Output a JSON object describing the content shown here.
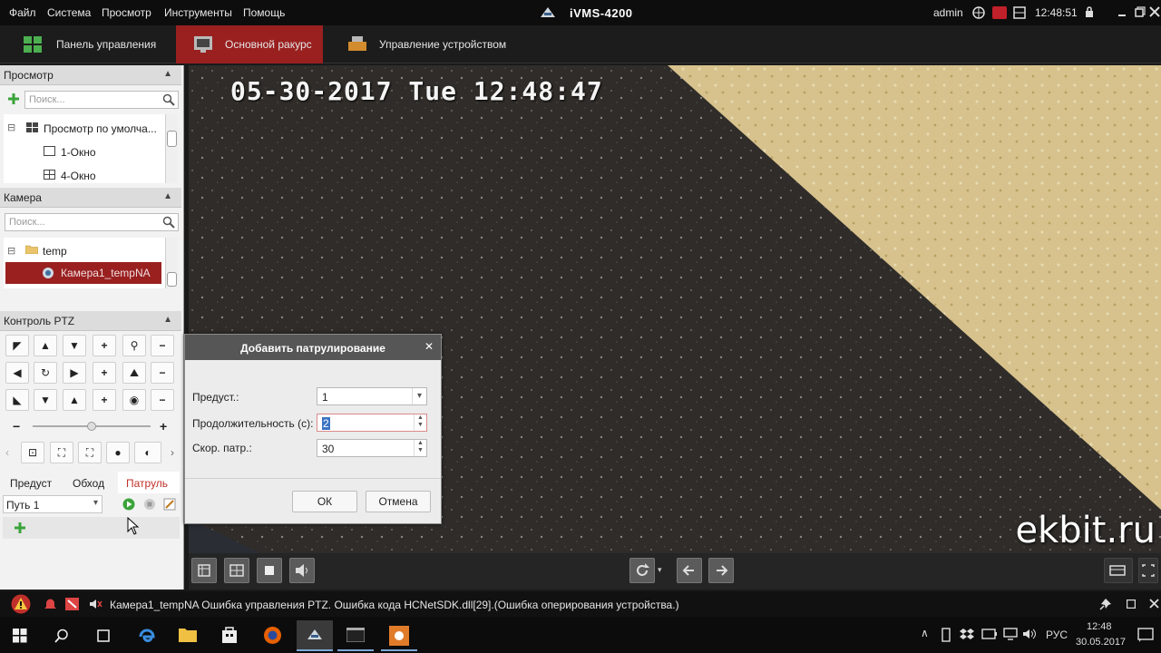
{
  "menubar": {
    "items": [
      "Файл",
      "Система",
      "Просмотр",
      "Инструменты",
      "Помощь"
    ],
    "app_title": "iVMS-4200",
    "user": "admin",
    "clock": "12:48:51"
  },
  "tabs": [
    {
      "label": "Панель управления"
    },
    {
      "label": "Основной ракурс"
    },
    {
      "label": "Управление устройством"
    }
  ],
  "view_section": {
    "title": "Просмотр",
    "search_placeholder": "Поиск...",
    "tree": [
      "Просмотр по умолча...",
      "1-Окно",
      "4-Окно"
    ]
  },
  "camera_section": {
    "title": "Камера",
    "search_placeholder": "Поиск...",
    "folder": "temp",
    "camera": "Камера1_tempNA"
  },
  "ptz_section": {
    "title": "Контроль PTZ",
    "subtabs": [
      "Предуст",
      "Обход",
      "Патруль"
    ],
    "path_value": "Путь 1"
  },
  "dialog": {
    "title": "Добавить патрулирование",
    "preset_label": "Предуст.:",
    "preset_value": "1",
    "duration_label": "Продолжительность (с):",
    "duration_value": "2",
    "speed_label": "Скор. патр.:",
    "speed_value": "30",
    "ok": "ОК",
    "cancel": "Отмена"
  },
  "video": {
    "timestamp": "05-30-2017 Tue 12:48:47",
    "watermark": "ekbit.ru"
  },
  "status": {
    "message": "Камера1_tempNA Ошибка управления PTZ. Ошибка кода HCNetSDK.dll[29].(Ошибка оперирования устройства.)"
  },
  "taskbar": {
    "lang": "РУС",
    "time": "12:48",
    "date": "30.05.2017"
  },
  "colors": {
    "accent_tab": "#9a2020",
    "selected_row": "#9a2020",
    "dialog_header": "#565656"
  }
}
